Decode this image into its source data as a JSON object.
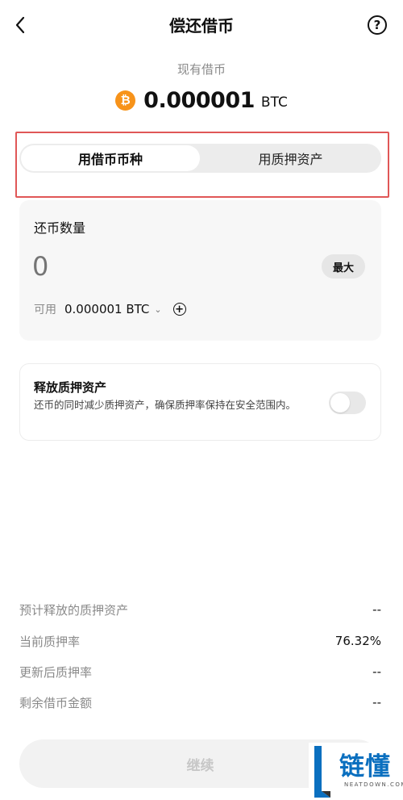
{
  "header": {
    "title": "偿还借币"
  },
  "balance": {
    "label": "现有借币",
    "amount": "0.000001",
    "unit": "BTC",
    "coin_symbol": "₿",
    "coin_color": "#f7931a"
  },
  "tabs": [
    {
      "label": "用借币币种",
      "active": true
    },
    {
      "label": "用质押资产",
      "active": false
    }
  ],
  "repay": {
    "label": "还币数量",
    "placeholder": "0",
    "max_label": "最大",
    "available_label": "可用",
    "available_value": "0.000001 BTC"
  },
  "release": {
    "title": "释放质押资产",
    "description": "还币的同时减少质押资产，确保质押率保持在安全范围内。",
    "enabled": false
  },
  "summary": [
    {
      "label": "预计释放的质押资产",
      "value": "--"
    },
    {
      "label": "当前质押率",
      "value": "76.32%"
    },
    {
      "label": "更新后质押率",
      "value": "--"
    },
    {
      "label": "剩余借币金额",
      "value": "--"
    }
  ],
  "footer": {
    "continue_label": "继续"
  },
  "watermark": {
    "text": "链懂",
    "sub": "NEATDOWN.COM"
  }
}
